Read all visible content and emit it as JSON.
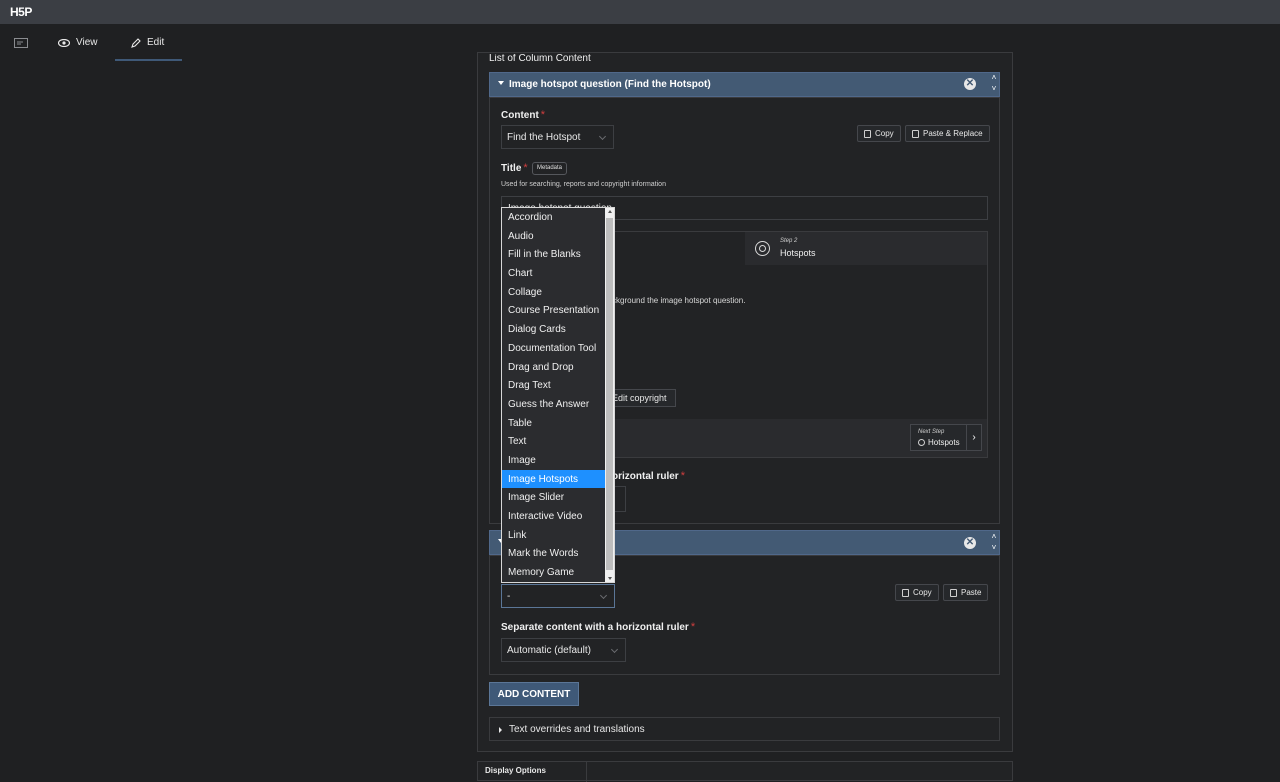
{
  "app": {
    "logo": "H5P"
  },
  "tabs": [
    {
      "label": "View"
    },
    {
      "label": "Edit"
    }
  ],
  "list_heading": "List of Column Content",
  "item1": {
    "header": "Image hotspot question (Find the Hotspot)",
    "content_label": "Content",
    "content_value": "Find the Hotspot",
    "copy_label": "Copy",
    "paste_replace_label": "Paste & Replace",
    "title_label": "Title",
    "metadata_label": "Metadata",
    "title_help": "Used for searching, reports and copyright information",
    "title_value": "Image hotspot question",
    "step2_small": "Step 2",
    "step2_label": "Hotspots",
    "bg_help_partial": "ckground the image hotspot question.",
    "edit_copyright": "Edit copyright",
    "next_step_small": "Next Step",
    "next_step_label": "Hotspots",
    "ruler_label_partial": "orizontal ruler"
  },
  "item2": {
    "selected_value": "-",
    "copy_label": "Copy",
    "paste_label": "Paste",
    "ruler_label": "Separate content with a horizontal ruler",
    "ruler_value": "Automatic (default)"
  },
  "dropdown_options": [
    "Accordion",
    "Audio",
    "Fill in the Blanks",
    "Chart",
    "Collage",
    "Course Presentation",
    "Dialog Cards",
    "Documentation Tool",
    "Drag and Drop",
    "Drag Text",
    "Guess the Answer",
    "Table",
    "Text",
    "Image",
    "Image Hotspots",
    "Image Slider",
    "Interactive Video",
    "Link",
    "Mark the Words",
    "Memory Game"
  ],
  "dropdown_selected": "Image Hotspots",
  "add_content_label": "ADD CONTENT",
  "overrides_label": "Text overrides and translations",
  "display_options_label": "Display Options",
  "colors": {
    "accent": "#3f5978",
    "header": "#435a74",
    "selected_option": "#1e90ff",
    "required": "#d23f3f"
  }
}
